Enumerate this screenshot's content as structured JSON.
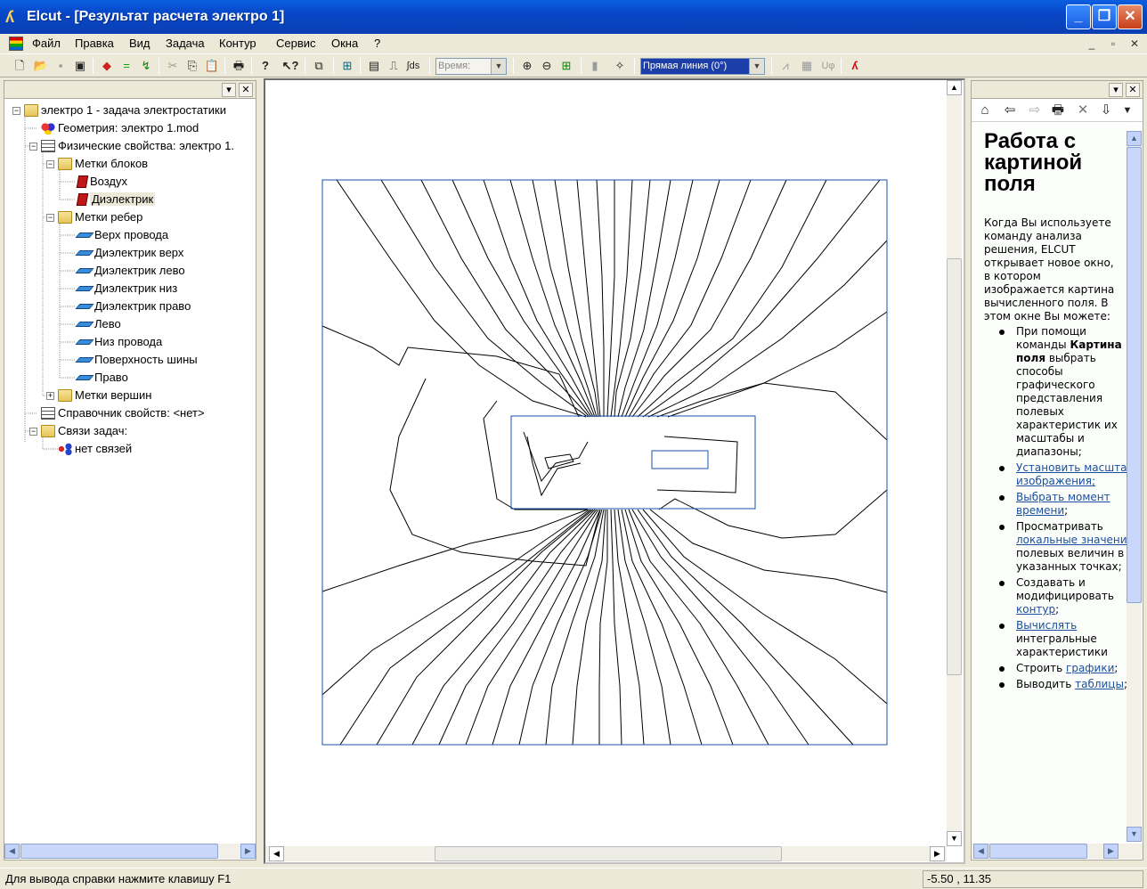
{
  "window": {
    "title": "Elcut - [Результат расчета электро 1]",
    "app_icon": "elcut-logo-icon"
  },
  "menu": {
    "items": [
      "Файл",
      "Правка",
      "Вид",
      "Задача",
      "Контур",
      "Сервис",
      "Окна",
      "?"
    ]
  },
  "toolbar": {
    "time_label": "Время:",
    "contour_combo": "Прямая линия (0°)"
  },
  "tree": {
    "root": "электро 1 - задача электростатики",
    "geometry": "Геометрия: электро 1.mod",
    "physprops": "Физические свойства: электро 1.",
    "block_labels": "Метки блоков",
    "blocks": [
      "Воздух",
      "Диэлектрик"
    ],
    "edge_labels": "Метки ребер",
    "edges": [
      "Верх провода",
      "Диэлектрик верх",
      "Диэлектрик лево",
      "Диэлектрик низ",
      "Диэлектрик право",
      "Лево",
      "Низ провода",
      "Поверхность шины",
      "Право"
    ],
    "vertex_labels": "Метки вершин",
    "library": "Справочник свойств: <нет>",
    "links": "Связи задач:",
    "no_links": "нет связей"
  },
  "help": {
    "title": "Работа с картиной поля",
    "intro": "Когда Вы используете команду анализа решения, ELCUT открывает новое окно, в котором изображается картина вычисленного поля. В этом окне Вы можете:",
    "items": [
      {
        "pre": "При помощи команды ",
        "bold": "Картина поля",
        "link": "",
        "post": " выбрать способы графического представления полевых характеристик их масштабы и диапазоны;"
      },
      {
        "pre": "",
        "bold": "",
        "link": "Установить масштаб изображения;",
        "post": ""
      },
      {
        "pre": "",
        "bold": "",
        "link": "Выбрать момент времени",
        "post": ";"
      },
      {
        "pre": "Просматривать ",
        "bold": "",
        "link": "локальные значения",
        "post": " полевых величин в указанных точках;"
      },
      {
        "pre": "Создавать и модифицировать ",
        "bold": "",
        "link": "контур",
        "post": ";"
      },
      {
        "pre": "",
        "bold": "",
        "link": "Вычислять",
        "post": " интегральные характеристики"
      },
      {
        "pre": "Строить ",
        "bold": "",
        "link": "графики",
        "post": ";"
      },
      {
        "pre": "Выводить ",
        "bold": "",
        "link": "таблицы",
        "post": ";"
      }
    ]
  },
  "status": {
    "text": "Для вывода справки нажмите клавишу F1",
    "coords": "-5.50 , 11.35"
  },
  "colors": {
    "titlebar": "#0a46c8",
    "boundary": "#1a4fb0",
    "contour": "#000000",
    "link": "#1a4f9e"
  }
}
